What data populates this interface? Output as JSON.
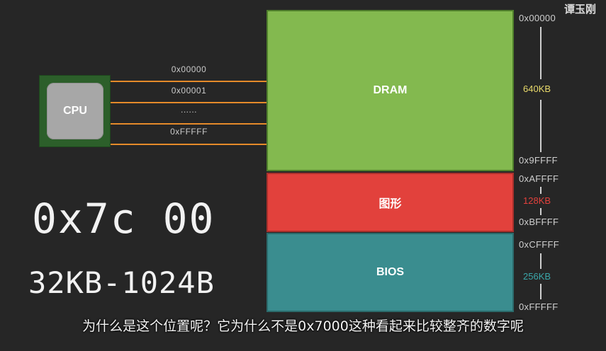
{
  "watermark": "谭玉刚",
  "cpu": {
    "label": "CPU"
  },
  "bus": {
    "labels": [
      "0x00000",
      "0x00001",
      "......",
      "0xFFFFF"
    ]
  },
  "memory_map": {
    "blocks": [
      {
        "label": "DRAM",
        "color": "#83b94f"
      },
      {
        "label": "图形",
        "color": "#e2413c"
      },
      {
        "label": "BIOS",
        "color": "#3a8d8f"
      }
    ],
    "addresses": [
      "0x00000",
      "0x9FFFF",
      "0xAFFFF",
      "0xBFFFF",
      "0xCFFFF",
      "0xFFFFF"
    ],
    "sizes": [
      {
        "label": "640KB",
        "color": "#e8d96a"
      },
      {
        "label": "128KB",
        "color": "#e2413c"
      },
      {
        "label": "256KB",
        "color": "#3aa6a9"
      }
    ]
  },
  "handwriting": {
    "hex": "0x7c 00",
    "size": "32KB-1024B"
  },
  "subtitle": "为什么是这个位置呢？它为什么不是0x7000这种看起来比较整齐的数字呢"
}
